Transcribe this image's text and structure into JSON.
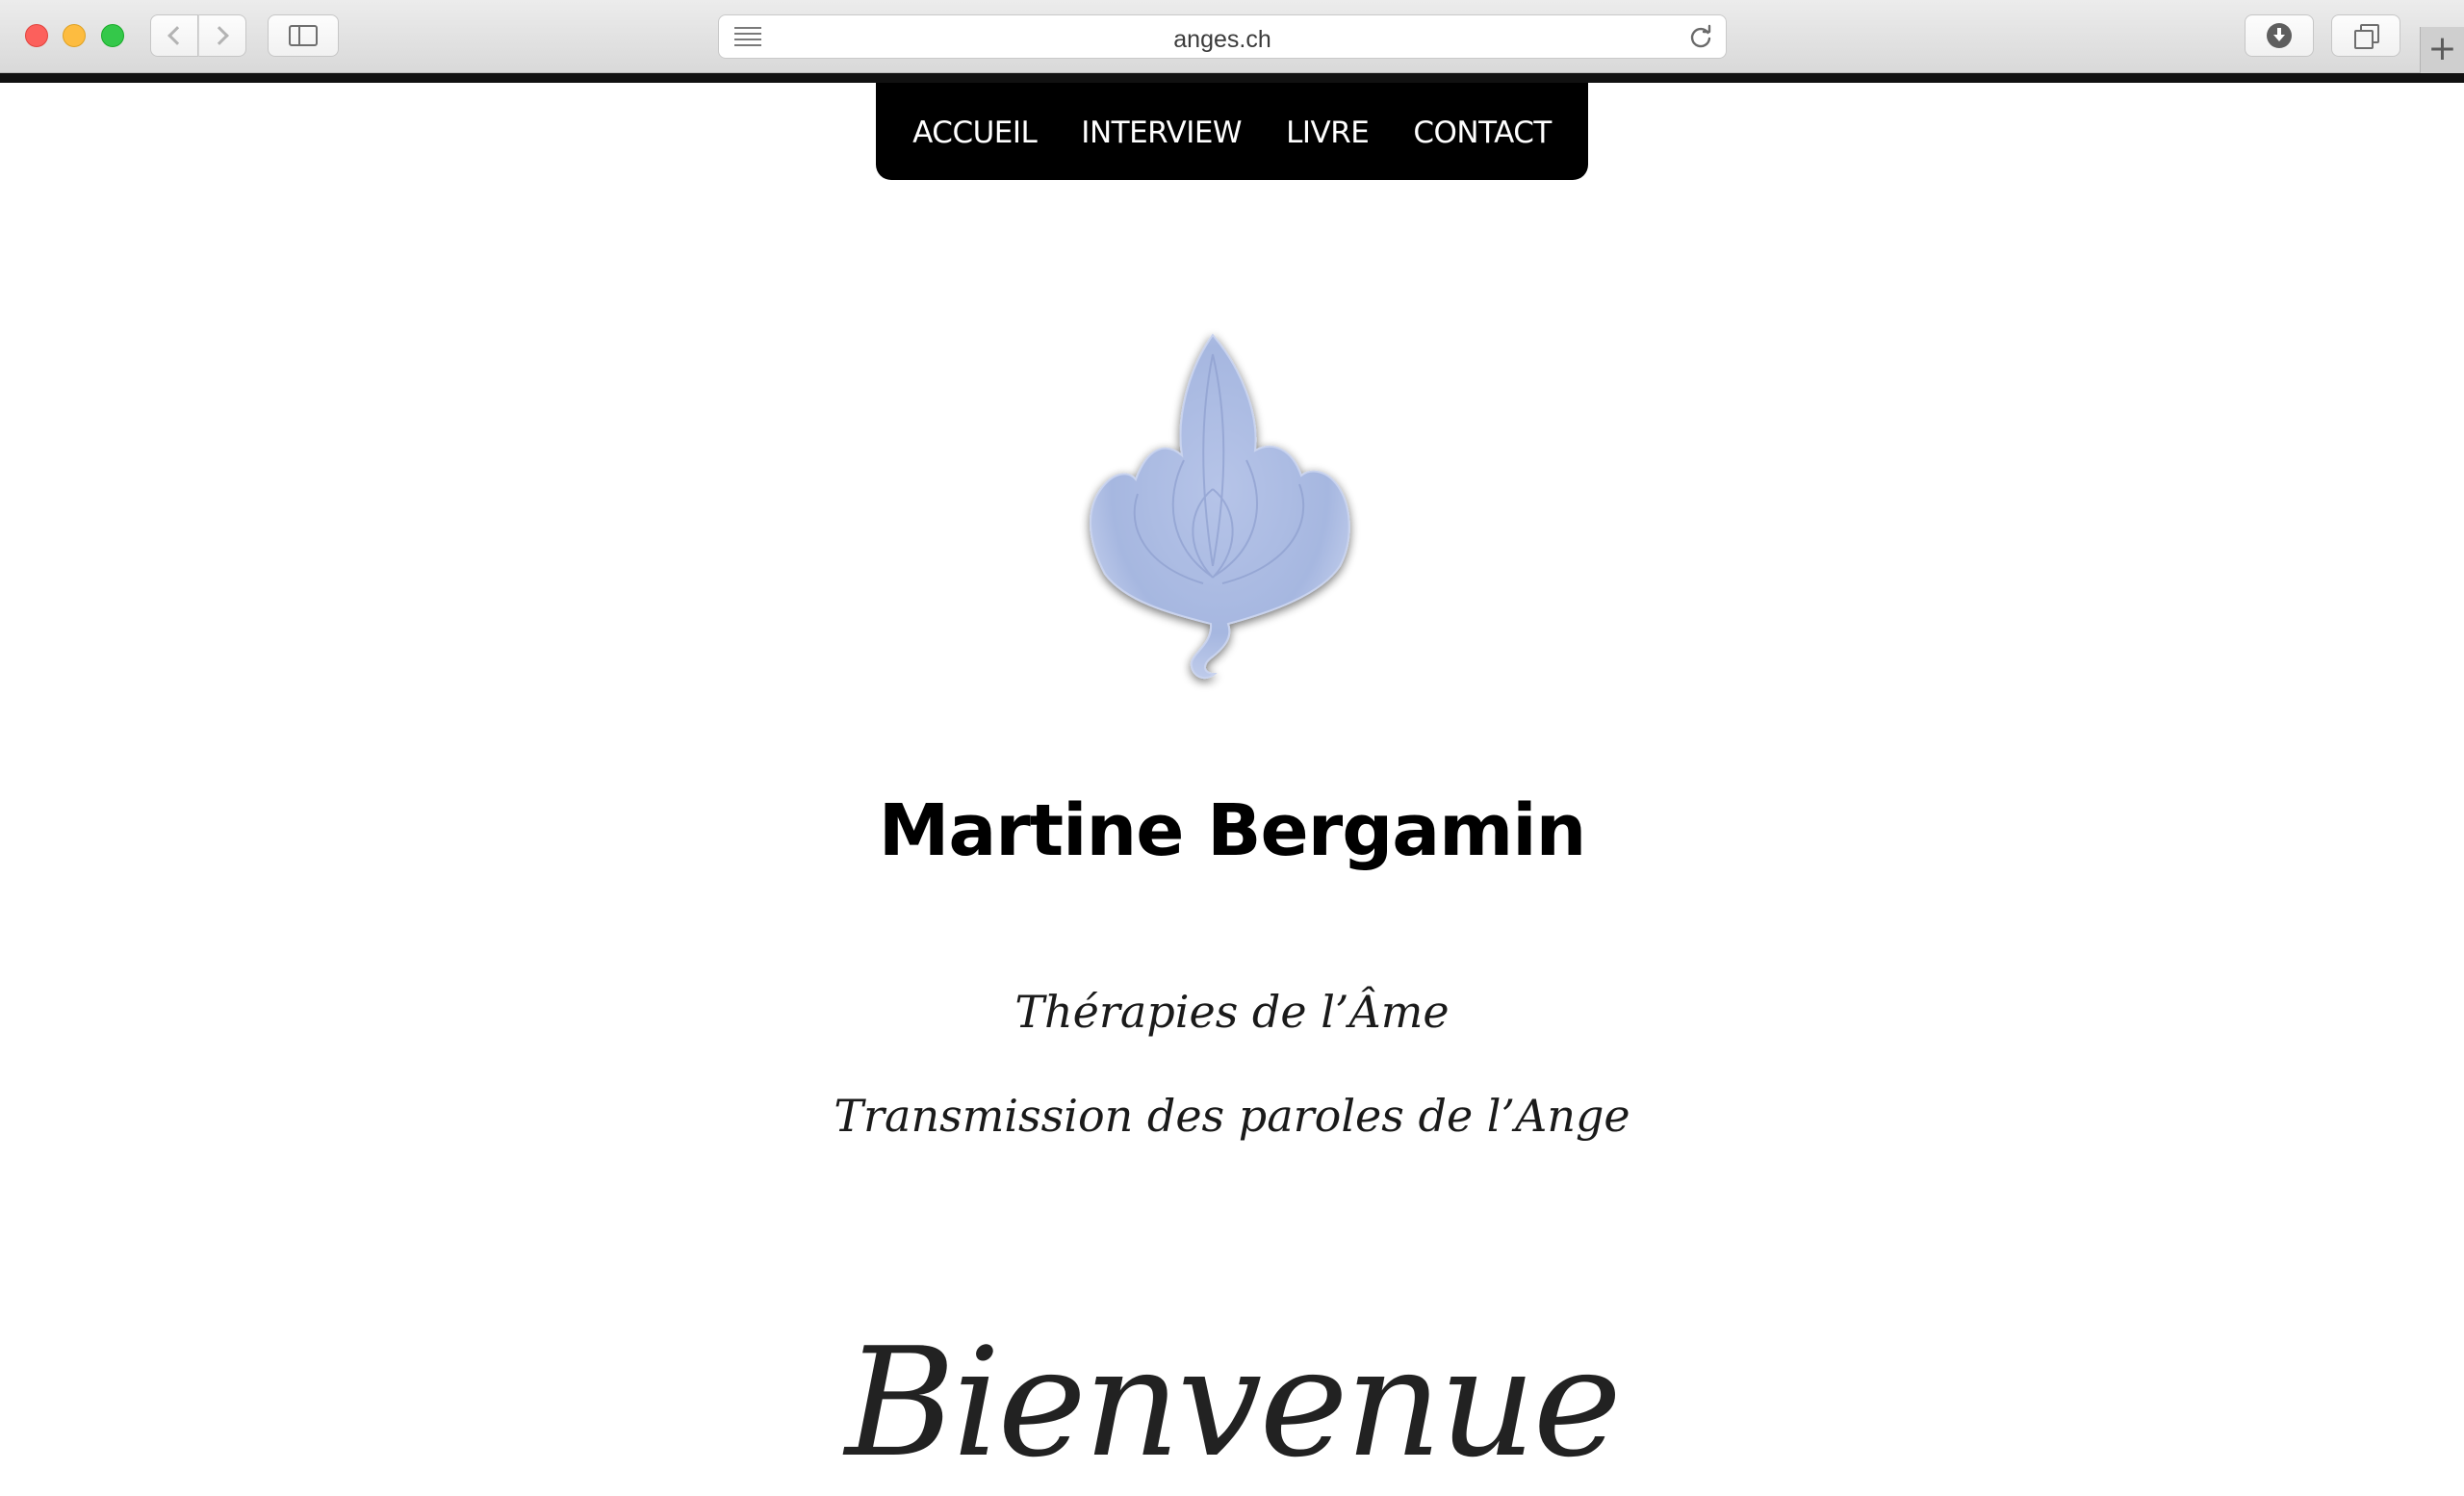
{
  "browser": {
    "url": "anges.ch",
    "new_tab_label": "+"
  },
  "site": {
    "nav": [
      "ACCUEIL",
      "INTERVIEW",
      "LIVRE",
      "CONTACT"
    ],
    "logo": "blue-leaf-icon",
    "name": "Martine Bergamin",
    "tagline_1": "Thérapies de l’Âme",
    "tagline_2": "Transmission des paroles de l’Ange",
    "welcome": "Bienvenue"
  },
  "colors": {
    "nav_background": "#000000",
    "nav_text": "#ffffff",
    "logo_fill": "#aebde3",
    "text": "#000000"
  }
}
